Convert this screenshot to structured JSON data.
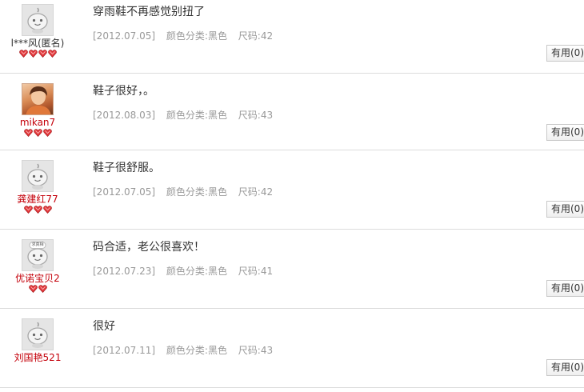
{
  "reviews": [
    {
      "username": "l***风(匿名)",
      "user_style": "dark",
      "avatar": "default-avatar-icon",
      "avatar_badge": "",
      "gems": 4,
      "text": "穿雨鞋不再感觉别扭了",
      "date": "[2012.07.05]",
      "color": "颜色分类:黑色",
      "size": "尺码:42",
      "helpful_label": "有用",
      "helpful_count": "(0)"
    },
    {
      "username": "mikan7",
      "user_style": "red",
      "avatar": "user-photo-avatar",
      "avatar_badge": "",
      "gems": 3,
      "text": "鞋子很好，。",
      "date": "[2012.08.03]",
      "color": "颜色分类:黑色",
      "size": "尺码:43",
      "helpful_label": "有用",
      "helpful_count": "(0)"
    },
    {
      "username": "龚建红77",
      "user_style": "red",
      "avatar": "default-avatar-icon",
      "avatar_badge": "",
      "gems": 3,
      "text": "鞋子很舒服。",
      "date": "[2012.07.05]",
      "color": "颜色分类:黑色",
      "size": "尺码:42",
      "helpful_label": "有用",
      "helpful_count": "(0)"
    },
    {
      "username": "优诺宝贝2",
      "user_style": "red",
      "avatar": "default-avatar-icon",
      "avatar_badge": "求真相",
      "gems": 2,
      "text": "码合适，老公很喜欢！",
      "date": "[2012.07.23]",
      "color": "颜色分类:黑色",
      "size": "尺码:41",
      "helpful_label": "有用",
      "helpful_count": "(0)"
    },
    {
      "username": "刘国艳521",
      "user_style": "red",
      "avatar": "default-avatar-icon",
      "avatar_badge": "",
      "gems": 0,
      "text": "很好",
      "date": "[2012.07.11]",
      "color": "颜色分类:黑色",
      "size": "尺码:43",
      "helpful_label": "有用",
      "helpful_count": "(0)"
    }
  ],
  "colors": {
    "username_red": "#c4000a",
    "meta_gray": "#999999",
    "gem_red": "#e4393c",
    "divider": "#dcdcdc"
  }
}
